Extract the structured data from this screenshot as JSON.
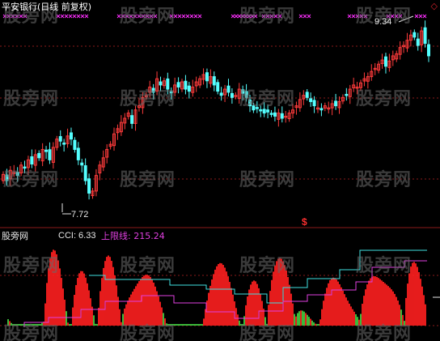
{
  "window": {
    "title": "平安银行(日线 前复权)",
    "corner_icon": "diamond-icon"
  },
  "price_panel": {
    "high_label": "9.34",
    "low_label": "7.72",
    "signal_marker": "$",
    "marker_color": "#ff30ff",
    "up_color": "#ff3b3b",
    "down_color": "#54ffff",
    "divider_color": "#8b1a1a"
  },
  "indicator_panel": {
    "name": "股旁网",
    "cci_label": "CCI: 6.33",
    "band_label": "上限线: 215.24",
    "positive_color": "#ff2020",
    "negative_color": "#40d040",
    "upper_line_color": "#40e0e0",
    "lower_line_color": "#e040e0"
  },
  "watermark": "股旁网",
  "chart_data": [
    {
      "type": "candlestick",
      "title": "平安银行(日线 前复权)",
      "annotations": [
        {
          "text": "9.34",
          "meaning": "high"
        },
        {
          "text": "7.72",
          "meaning": "low"
        }
      ],
      "ylim": [
        7.5,
        9.5
      ],
      "close": [
        7.96,
        7.9,
        8.0,
        7.98,
        7.95,
        8.05,
        8.02,
        8.1,
        8.06,
        8.15,
        8.12,
        8.2,
        8.18,
        8.1,
        8.22,
        8.3,
        8.28,
        8.25,
        8.33,
        8.3,
        8.2,
        8.1,
        8.05,
        7.9,
        7.78,
        7.8,
        7.95,
        8.05,
        8.12,
        8.2,
        8.25,
        8.35,
        8.4,
        8.46,
        8.5,
        8.55,
        8.45,
        8.58,
        8.62,
        8.7,
        8.72,
        8.8,
        8.75,
        8.88,
        8.82,
        8.86,
        8.78,
        8.75,
        8.82,
        8.8,
        8.85,
        8.78,
        8.76,
        8.8,
        8.85,
        8.88,
        8.92,
        8.86,
        8.9,
        8.82,
        8.76,
        8.72,
        8.78,
        8.75,
        8.7,
        8.72,
        8.78,
        8.74,
        8.7,
        8.62,
        8.58,
        8.6,
        8.58,
        8.55,
        8.56,
        8.54,
        8.52,
        8.55,
        8.5,
        8.52,
        8.55,
        8.58,
        8.62,
        8.68,
        8.72,
        8.7,
        8.66,
        8.62,
        8.6,
        8.58,
        8.62,
        8.6,
        8.64,
        8.62,
        8.66,
        8.7,
        8.72,
        8.78,
        8.82,
        8.8,
        8.84,
        8.88,
        8.9,
        8.95,
        8.98,
        9.02,
        9.06,
        9.0,
        9.05,
        9.1,
        9.12,
        9.18,
        9.2,
        9.25,
        9.3,
        9.28,
        9.2,
        9.34,
        9.22,
        9.1
      ],
      "markers_row_present": true
    },
    {
      "type": "bar",
      "series": [
        {
          "name": "CCI",
          "values_note": "oscillator bars colored red above zero, green below"
        }
      ],
      "last_values": {
        "CCI": 6.33,
        "上限线": 215.24
      }
    }
  ]
}
